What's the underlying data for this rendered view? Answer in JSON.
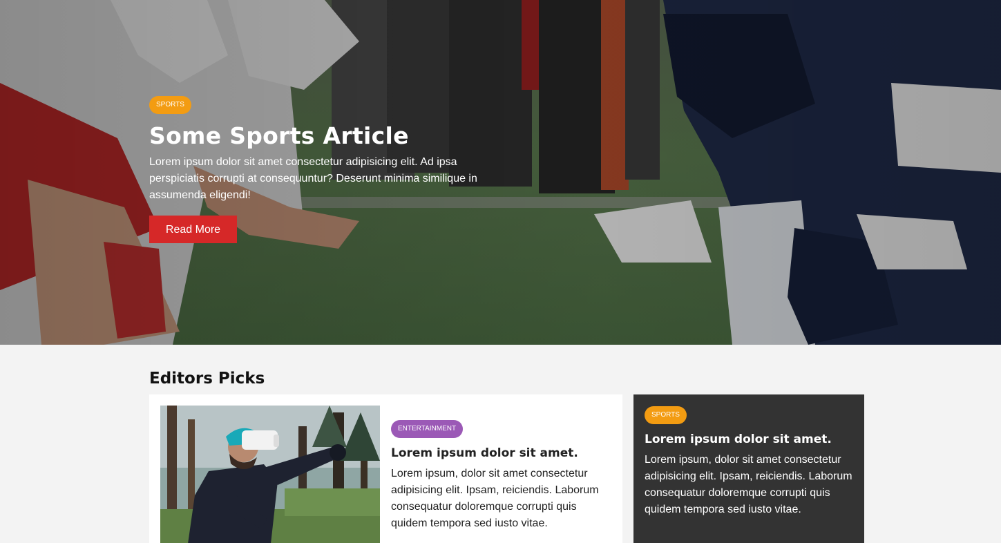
{
  "hero": {
    "category": "SPORTS",
    "title": "Some Sports Article",
    "text": "Lorem ipsum dolor sit amet consectetur adipisicing elit. Ad ipsa perspiciatis corrupti at consequuntur? Deserunt minima similique in assumenda eligendi!",
    "button_label": "Read More"
  },
  "editors_picks": {
    "heading": "Editors Picks",
    "main_card": {
      "category": "ENTERTAINMENT",
      "title": "Lorem ipsum dolor sit amet.",
      "text": "Lorem ipsum, dolor sit amet consectetur adipisicing elit. Ipsam, reiciendis. Laborum consequatur doloremque corrupti quis quidem tempora sed iusto vitae."
    },
    "side_card": {
      "category": "SPORTS",
      "title": "Lorem ipsum dolor sit amet.",
      "text": "Lorem ipsum, dolor sit amet consectetur adipisicing elit. Ipsam, reiciendis. Laborum consequatur doloremque corrupti quis quidem tempora sed iusto vitae."
    }
  },
  "colors": {
    "sports_badge": "#f39c12",
    "entertainment_badge": "#9b59b6",
    "read_more_button": "#d62828",
    "dark_card": "#333333",
    "page_background": "#f3f3f3"
  }
}
